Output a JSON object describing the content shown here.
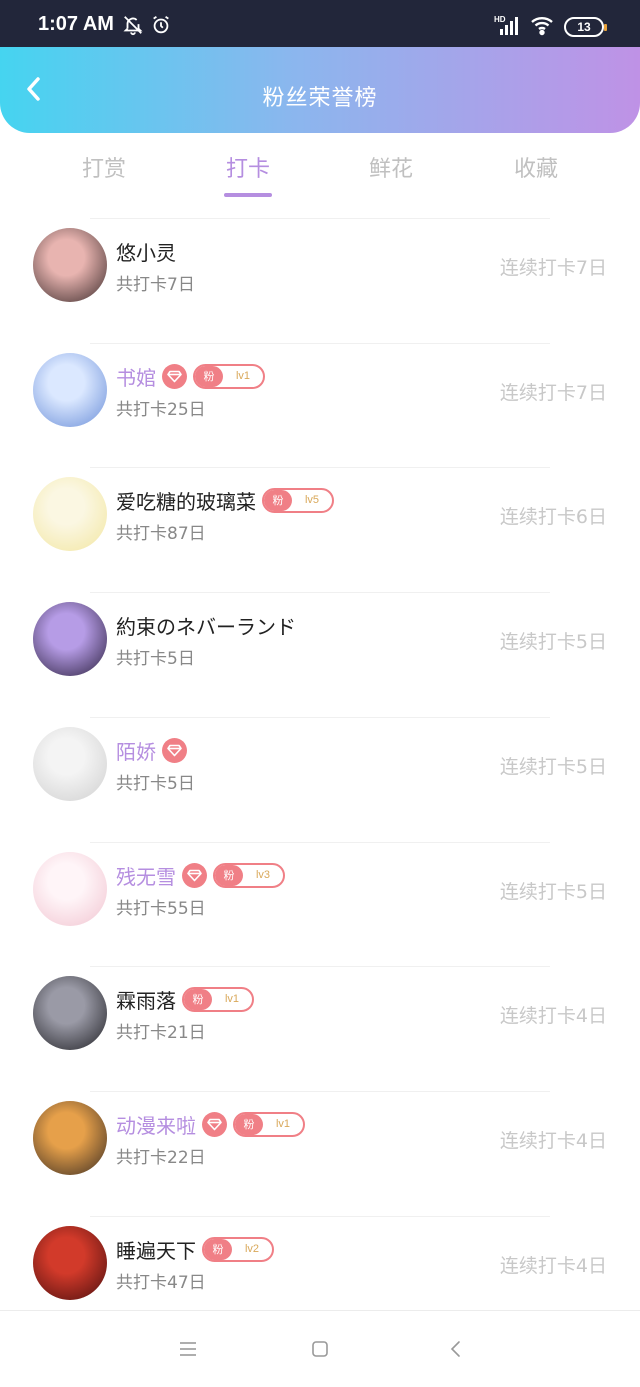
{
  "status_bar": {
    "time": "1:07 AM",
    "battery": "13",
    "icons": [
      "mute-bell-icon",
      "alarm-icon",
      "hd-signal-icon",
      "wifi-icon",
      "battery-icon"
    ]
  },
  "header": {
    "title": "粉丝荣誉榜",
    "back_icon": "chevron-left-icon"
  },
  "tabs": [
    {
      "label": "打赏",
      "active": false
    },
    {
      "label": "打卡",
      "active": true
    },
    {
      "label": "鲜花",
      "active": false
    },
    {
      "label": "收藏",
      "active": false
    }
  ],
  "fans": [
    {
      "name": "悠小灵",
      "vip": false,
      "diamond": false,
      "fan_label": "",
      "fan_level": "",
      "total": "共打卡7日",
      "streak": "连续打卡7日",
      "avatar_colors": [
        "#3a2a2a",
        "#e8b4b0"
      ]
    },
    {
      "name": "书婠",
      "vip": true,
      "diamond": true,
      "fan_label": "粉",
      "fan_level": "lv1",
      "total": "共打卡25日",
      "streak": "连续打卡7日",
      "avatar_colors": [
        "#6a8ed8",
        "#dbe8ff"
      ]
    },
    {
      "name": "爱吃糖的玻璃菜",
      "vip": false,
      "diamond": false,
      "fan_label": "粉",
      "fan_level": "lv5",
      "total": "共打卡87日",
      "streak": "连续打卡6日",
      "avatar_colors": [
        "#f2e6a0",
        "#fbf7e2"
      ]
    },
    {
      "name": "約束のネバーランド",
      "vip": false,
      "diamond": false,
      "fan_label": "",
      "fan_level": "",
      "total": "共打卡5日",
      "streak": "连续打卡5日",
      "avatar_colors": [
        "#2a1f3d",
        "#b69ce6"
      ]
    },
    {
      "name": "陌娇",
      "vip": true,
      "diamond": true,
      "fan_label": "",
      "fan_level": "",
      "total": "共打卡5日",
      "streak": "连续打卡5日",
      "avatar_colors": [
        "#cfcfcf",
        "#f4f4f4"
      ]
    },
    {
      "name": "残无雪",
      "vip": true,
      "diamond": true,
      "fan_label": "粉",
      "fan_level": "lv3",
      "total": "共打卡55日",
      "streak": "连续打卡5日",
      "avatar_colors": [
        "#f1c4d0",
        "#fff5f8"
      ]
    },
    {
      "name": "霖雨落",
      "vip": false,
      "diamond": false,
      "fan_label": "粉",
      "fan_level": "lv1",
      "total": "共打卡21日",
      "streak": "连续打卡4日",
      "avatar_colors": [
        "#1f1f24",
        "#9a9aa6"
      ]
    },
    {
      "name": "动漫来啦",
      "vip": true,
      "diamond": true,
      "fan_label": "粉",
      "fan_level": "lv1",
      "total": "共打卡22日",
      "streak": "连续打卡4日",
      "avatar_colors": [
        "#3a2c22",
        "#e6a04a"
      ]
    },
    {
      "name": "睡遍天下",
      "vip": false,
      "diamond": false,
      "fan_label": "粉",
      "fan_level": "lv2",
      "total": "共打卡47日",
      "streak": "连续打卡4日",
      "avatar_colors": [
        "#4a0e0e",
        "#d23a2a"
      ]
    }
  ],
  "bottom_nav": {
    "icons": [
      "menu-icon",
      "home-square-icon",
      "back-triangle-icon"
    ]
  },
  "colors": {
    "accent": "#b58ee0",
    "badge": "#f07f86",
    "header_gradient": [
      "#45d4f0",
      "#8ab7ee",
      "#bf92e6"
    ]
  }
}
